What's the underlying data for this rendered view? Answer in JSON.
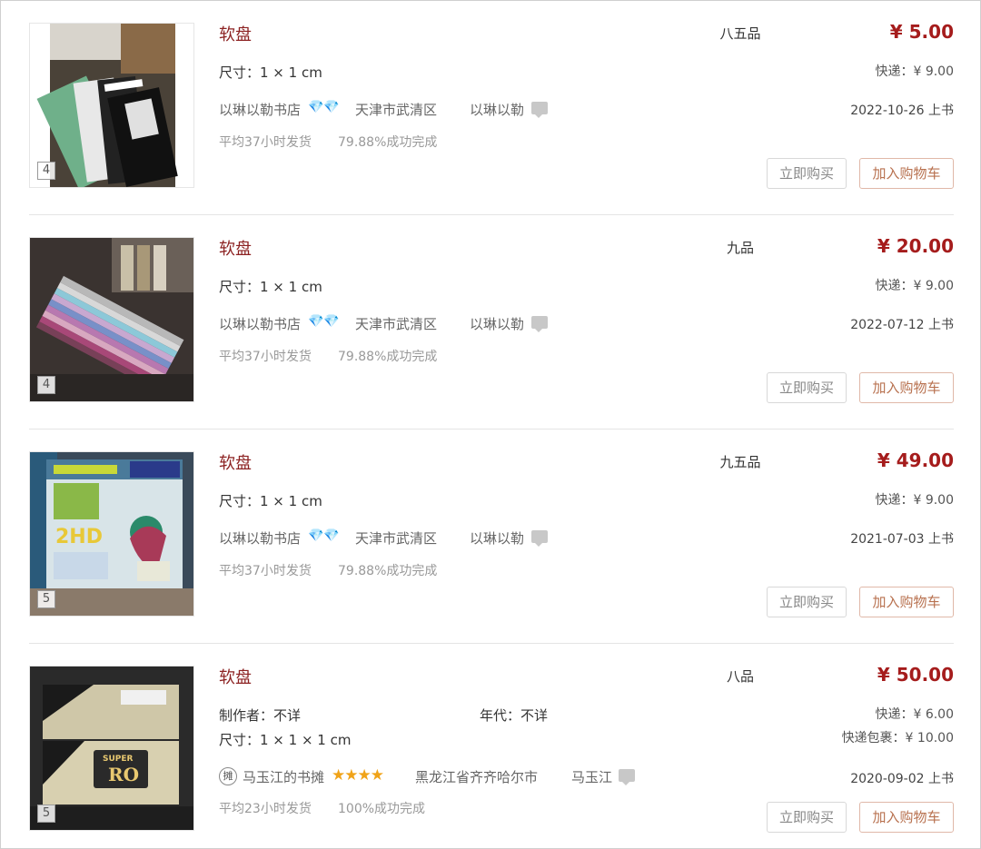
{
  "listings": [
    {
      "title": "软盘",
      "condition": "八五品",
      "price": "¥ 5.00",
      "size": "尺寸：1 × 1 cm",
      "shipping": "快递：¥ 9.00",
      "shop_name": "以琳以勒书店",
      "shop_rating_icon": "diamond-icon",
      "location": "天津市武清区",
      "seller": "以琳以勒",
      "date": "2022-10-26 上书",
      "avg_ship": "平均37小时发货",
      "success_rate": "79.88%成功完成",
      "image_count": "4",
      "buy_label": "立即购买",
      "cart_label": "加入购物车"
    },
    {
      "title": "软盘",
      "condition": "九品",
      "price": "¥ 20.00",
      "size": "尺寸：1 × 1 cm",
      "shipping": "快递：¥ 9.00",
      "shop_name": "以琳以勒书店",
      "shop_rating_icon": "diamond-icon",
      "location": "天津市武清区",
      "seller": "以琳以勒",
      "date": "2022-07-12 上书",
      "avg_ship": "平均37小时发货",
      "success_rate": "79.88%成功完成",
      "image_count": "4",
      "buy_label": "立即购买",
      "cart_label": "加入购物车"
    },
    {
      "title": "软盘",
      "condition": "九五品",
      "price": "¥ 49.00",
      "size": "尺寸：1 × 1 cm",
      "shipping": "快递：¥ 9.00",
      "shop_name": "以琳以勒书店",
      "shop_rating_icon": "diamond-icon",
      "location": "天津市武清区",
      "seller": "以琳以勒",
      "date": "2021-07-03 上书",
      "avg_ship": "平均37小时发货",
      "success_rate": "79.88%成功完成",
      "image_count": "5",
      "buy_label": "立即购买",
      "cart_label": "加入购物车"
    },
    {
      "title": "软盘",
      "condition": "八品",
      "price": "¥ 50.00",
      "maker": "制作者：不详",
      "era": "年代：不详",
      "size": "尺寸：1 × 1 × 1 cm",
      "shipping": "快递：¥ 6.00",
      "shipping2": "快递包裹：¥ 10.00",
      "shop_badge": "摊",
      "shop_name": "马玉江的书摊",
      "shop_rating_icon": "star-icon",
      "shop_rating_count": 4,
      "location": "黑龙江省齐齐哈尔市",
      "seller": "马玉江",
      "date": "2020-09-02 上书",
      "avg_ship": "平均23小时发货",
      "success_rate": "100%成功完成",
      "image_count": "5",
      "buy_label": "立即购买",
      "cart_label": "加入购物车"
    }
  ],
  "colors": {
    "title": "#8c2222",
    "price": "#a51c1c",
    "diamond": "#5bb6e8",
    "star": "#f0a318",
    "cart_button": "#b8714f"
  }
}
